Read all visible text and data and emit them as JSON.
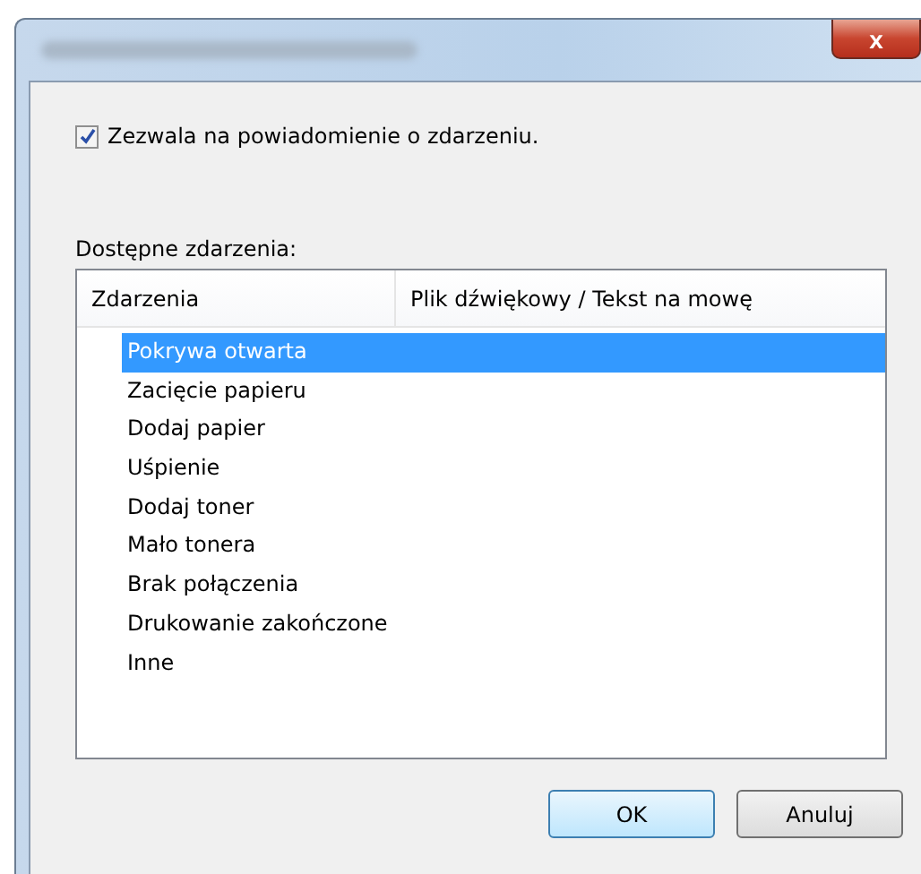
{
  "window": {
    "close": "x"
  },
  "notify": {
    "label": "Zezwala na powiadomienie o zdarzeniu.",
    "checked": true
  },
  "events_label": "Dostępne zdarzenia:",
  "table": {
    "columns": [
      "Zdarzenia",
      "Plik dźwiękowy / Tekst na mowę"
    ],
    "rows": [
      {
        "name": "Pokrywa otwarta",
        "selected": true
      },
      {
        "name": "Zacięcie papieru",
        "selected": false
      },
      {
        "name": "Dodaj papier",
        "selected": false
      },
      {
        "name": "Uśpienie",
        "selected": false
      },
      {
        "name": "Dodaj toner",
        "selected": false
      },
      {
        "name": "Mało tonera",
        "selected": false
      },
      {
        "name": "Brak połączenia",
        "selected": false
      },
      {
        "name": "Drukowanie zakończone",
        "selected": false
      },
      {
        "name": "Inne",
        "selected": false
      }
    ]
  },
  "buttons": [
    "OK",
    "Anuluj"
  ]
}
